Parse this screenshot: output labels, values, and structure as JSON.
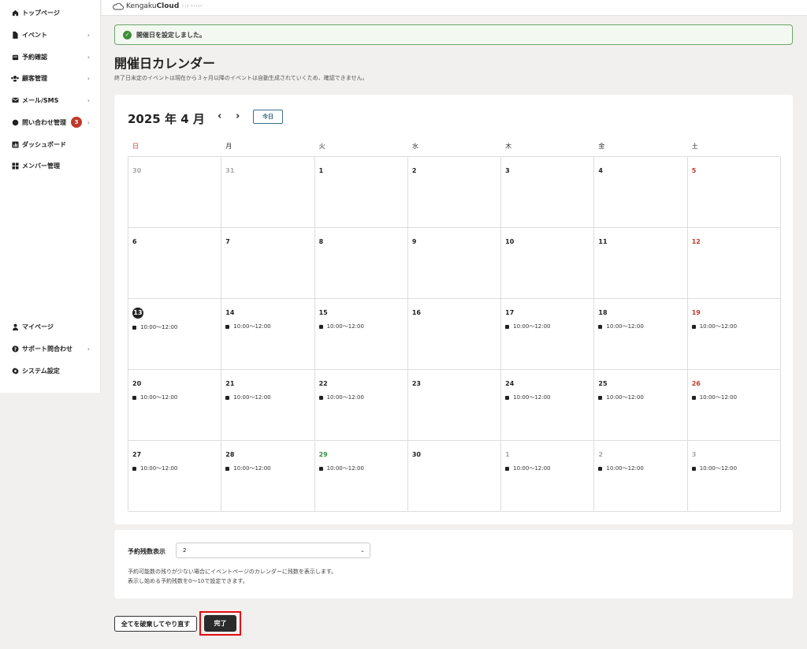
{
  "sidebar": {
    "items": [
      {
        "label": "トップページ",
        "icon": "home-icon"
      },
      {
        "label": "イベント",
        "icon": "document-icon",
        "chevron": true
      },
      {
        "label": "予約確認",
        "icon": "calendar-icon",
        "chevron": true
      },
      {
        "label": "顧客管理",
        "icon": "users-icon",
        "chevron": true
      },
      {
        "label": "メール/SMS",
        "icon": "mail-icon",
        "chevron": true
      },
      {
        "label": "問い合わせ管理",
        "icon": "chat-icon",
        "chevron": true,
        "badge": "3"
      },
      {
        "label": "ダッシュボード",
        "icon": "chart-icon"
      },
      {
        "label": "メンバー管理",
        "icon": "grid-icon"
      },
      {
        "label": "マイページ",
        "icon": "person-icon"
      },
      {
        "label": "サポート問合わせ",
        "icon": "help-icon",
        "chevron": true
      },
      {
        "label": "システム設定",
        "icon": "gear-icon"
      }
    ]
  },
  "header": {
    "logo_prefix": "Kengaku",
    "logo_bold": "Cloud",
    "logo_sub": "ｹﾝｶﾞｸｸﾗｳﾄﾞ"
  },
  "alert": {
    "message": "開催日を設定しました。"
  },
  "page": {
    "title": "開催日カレンダー",
    "description": "終了日未定のイベントは現在から３ヶ月以降のイベントは自動生成されていくため、確認できません。"
  },
  "calendar": {
    "month_label": "2025 年 4 月",
    "prev": "‹",
    "next": "›",
    "today_label": "今日",
    "weekdays": [
      "日",
      "月",
      "火",
      "水",
      "木",
      "金",
      "土"
    ],
    "weeks": [
      [
        {
          "day": "30",
          "style": "muted"
        },
        {
          "day": "31",
          "style": "muted"
        },
        {
          "day": "1"
        },
        {
          "day": "2"
        },
        {
          "day": "3"
        },
        {
          "day": "4"
        },
        {
          "day": "5",
          "style": "red"
        }
      ],
      [
        {
          "day": "6"
        },
        {
          "day": "7"
        },
        {
          "day": "8"
        },
        {
          "day": "9"
        },
        {
          "day": "10"
        },
        {
          "day": "11"
        },
        {
          "day": "12",
          "style": "red"
        }
      ],
      [
        {
          "day": "13",
          "style": "today",
          "event": "10:00〜12:00"
        },
        {
          "day": "14",
          "event": "10:00〜12:00"
        },
        {
          "day": "15",
          "event": "10:00〜12:00"
        },
        {
          "day": "16"
        },
        {
          "day": "17",
          "event": "10:00〜12:00"
        },
        {
          "day": "18",
          "event": "10:00〜12:00"
        },
        {
          "day": "19",
          "style": "red",
          "event": "10:00〜12:00"
        }
      ],
      [
        {
          "day": "20",
          "event": "10:00〜12:00"
        },
        {
          "day": "21",
          "event": "10:00〜12:00"
        },
        {
          "day": "22",
          "event": "10:00〜12:00"
        },
        {
          "day": "23"
        },
        {
          "day": "24",
          "event": "10:00〜12:00"
        },
        {
          "day": "25",
          "event": "10:00〜12:00"
        },
        {
          "day": "26",
          "style": "red",
          "event": "10:00〜12:00"
        }
      ],
      [
        {
          "day": "27",
          "event": "10:00〜12:00"
        },
        {
          "day": "28",
          "event": "10:00〜12:00"
        },
        {
          "day": "29",
          "style": "green",
          "event": "10:00〜12:00"
        },
        {
          "day": "30"
        },
        {
          "day": "1",
          "style": "muted",
          "event": "10:00〜12:00"
        },
        {
          "day": "2",
          "style": "muted",
          "event": "10:00〜12:00"
        },
        {
          "day": "3",
          "style": "muted",
          "event": "10:00〜12:00"
        }
      ]
    ]
  },
  "remaining": {
    "label": "予約残数表示",
    "value": "2",
    "help1": "予約可能数の残りが少ない場合にイベントページのカレンダーに残数を表示します。",
    "help2": "表示し始める予約残数を0〜10で設定できます。"
  },
  "actions": {
    "reset_label": "全てを破棄してやり直す",
    "done_label": "完了"
  },
  "colors": {
    "accent_red": "#c0392b",
    "success_green": "#3f8d3b",
    "highlight_frame": "#e10d0d"
  }
}
